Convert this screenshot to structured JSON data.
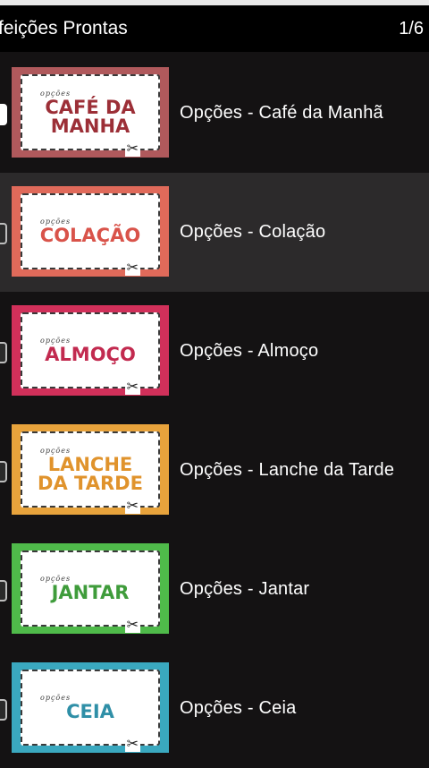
{
  "header": {
    "title": "feições Prontas",
    "page": "1/6"
  },
  "items": [
    {
      "small": "opções",
      "big1": "CAFÉ DA",
      "big2": "MANHA",
      "label": "Opções - Café da Manhã",
      "frame_color": "#b0595c",
      "text_color": "#9c2f37"
    },
    {
      "small": "opções",
      "big1": "COLAÇÃO",
      "big2": "",
      "label": "Opções - Colação",
      "frame_color": "#e06a5a",
      "text_color": "#d9534a"
    },
    {
      "small": "opções",
      "big1": "ALMOÇO",
      "big2": "",
      "label": "Opções - Almoço",
      "frame_color": "#d1305a",
      "text_color": "#c22a4f"
    },
    {
      "small": "opções",
      "big1": "LANCHE",
      "big2": "DA TARDE",
      "label": "Opções - Lanche da Tarde",
      "frame_color": "#e8a33c",
      "text_color": "#e0932c"
    },
    {
      "small": "opções",
      "big1": "JANTAR",
      "big2": "",
      "label": "Opções - Jantar",
      "frame_color": "#4fba4a",
      "text_color": "#3f9c3b"
    },
    {
      "small": "opções",
      "big1": "CEIA",
      "big2": "",
      "label": "Opções - Ceia",
      "frame_color": "#3aa8bf",
      "text_color": "#2f8fa7"
    }
  ],
  "icons": {
    "scissors": "scissors-icon"
  }
}
